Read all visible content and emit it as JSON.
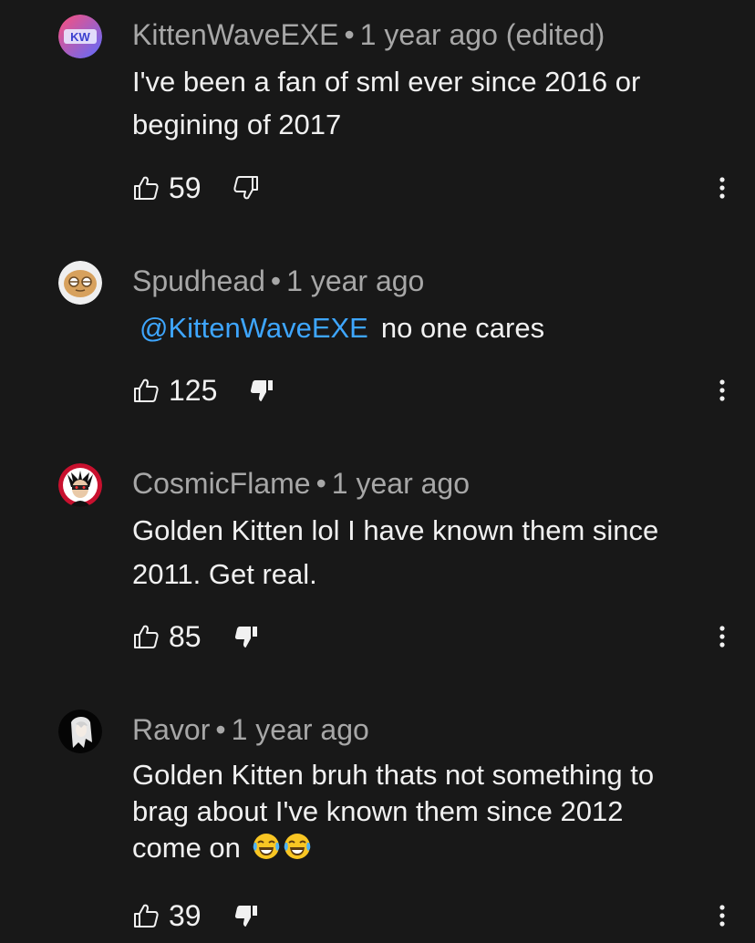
{
  "comments": [
    {
      "author": "KittenWaveEXE",
      "time": "1 year ago (edited)",
      "avatar_text": "KW",
      "body_lines": [
        "I've been a fan of sml ever since 2016 or",
        "begining of 2017"
      ],
      "likes": "59",
      "disliked": false
    },
    {
      "author": "Spudhead",
      "time": "1 year ago",
      "mention": "@KittenWaveEXE",
      "body": "no one cares",
      "likes": "125",
      "disliked": true
    },
    {
      "author": "CosmicFlame",
      "time": "1 year ago",
      "body_lines": [
        "Golden Kitten lol I have known them since",
        "2011. Get real."
      ],
      "likes": "85",
      "disliked": true
    },
    {
      "author": "Ravor",
      "time": "1 year ago",
      "body_lines": [
        "Golden Kitten bruh thats not something to",
        "brag about I've known them since 2012",
        "come on"
      ],
      "emojis": [
        "face-with-tears-of-joy-icon",
        "face-with-tears-of-joy-icon"
      ],
      "likes": "39",
      "disliked": true
    }
  ],
  "separator": "•",
  "colors": {
    "background": "#181818",
    "text": "#f1f1f1",
    "meta": "#a7a7a7",
    "mention": "#3ea6ff"
  }
}
